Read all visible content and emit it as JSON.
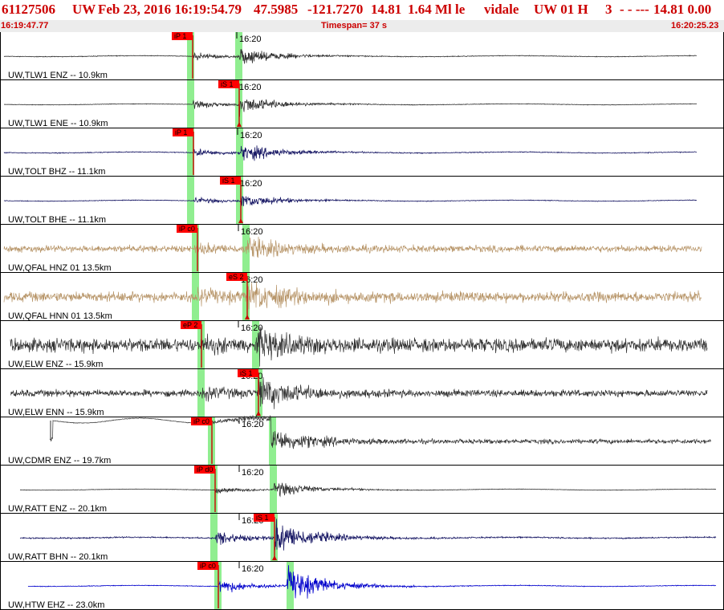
{
  "header": {
    "event_id": "61127506",
    "network": "UW",
    "datetime": "Feb 23, 2016 16:19:54.79",
    "latitude": "47.5985",
    "longitude": "-121.7270",
    "depth": "14.81",
    "magnitude": "1.64 Ml le",
    "analyst": "vidale",
    "source_info": "UW 01 H",
    "count": "3",
    "quality": "- - ---",
    "depth_fixed": "14.81 0.00"
  },
  "subheader": {
    "start_time": "16:19:47.77",
    "timespan": "Timespan=  37 s",
    "end_time": "16:20:25.23"
  },
  "colors": {
    "header_text": "#cc0000",
    "window_bar": "#90ee90",
    "pick_flag": "#ff0000",
    "trace_dark": "#333333",
    "trace_navy": "#1a1a66",
    "trace_tan": "#b8966a",
    "trace_blue": "#0000cc",
    "subheader_bg": "#ececec"
  },
  "minute_tick_label": "16:20",
  "channels": [
    {
      "label": "UW,TLW1 ENZ -- 10.9km",
      "color": "#333333",
      "pick": "iP 1",
      "pick_phase": "P"
    },
    {
      "label": "UW,TLW1 ENE -- 10.9km",
      "color": "#333333",
      "pick": "iS 1",
      "pick_phase": "S"
    },
    {
      "label": "UW,TOLT BHZ -- 11.1km",
      "color": "#1a1a66",
      "pick": "iP 1",
      "pick_phase": "P"
    },
    {
      "label": "UW,TOLT BHE -- 11.1km",
      "color": "#1a1a66",
      "pick": "iS 1",
      "pick_phase": "S"
    },
    {
      "label": "UW,QFAL HNZ 01 13.5km",
      "color": "#b8966a",
      "pick": "iP c0",
      "pick_phase": "P"
    },
    {
      "label": "UW,QFAL HNN 01 13.5km",
      "color": "#b8966a",
      "pick": "eS 2",
      "pick_phase": "S"
    },
    {
      "label": "UW,ELW ENZ -- 15.9km",
      "color": "#333333",
      "pick": "eP 2",
      "pick_phase": "P"
    },
    {
      "label": "UW,ELW ENN -- 15.9km",
      "color": "#333333",
      "pick": "iS 1",
      "pick_phase": "S"
    },
    {
      "label": "UW,CDMR ENZ -- 19.7km",
      "color": "#333333",
      "pick": "iP c0",
      "pick_phase": "P"
    },
    {
      "label": "UW,RATT ENZ -- 20.1km",
      "color": "#333333",
      "pick": "iP d0",
      "pick_phase": "P"
    },
    {
      "label": "UW,RATT BHN -- 20.1km",
      "color": "#1a1a66",
      "pick": "iS 1",
      "pick_phase": "S"
    },
    {
      "label": "UW,HTW EHZ -- 23.0km",
      "color": "#0000cc",
      "pick": "iP c0",
      "pick_phase": "P"
    }
  ]
}
